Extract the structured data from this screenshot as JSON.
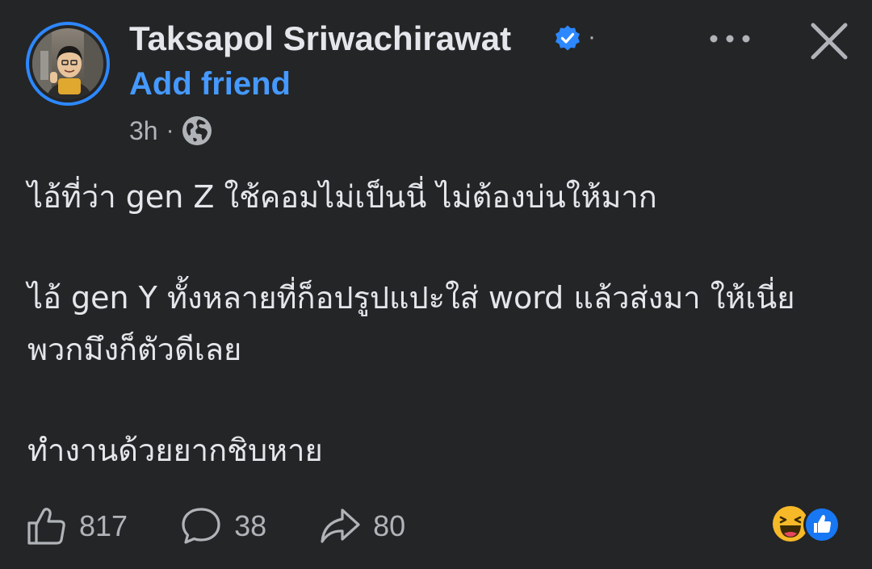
{
  "post": {
    "author": {
      "name": "Taksapol Sriwachirawat",
      "verified": true,
      "add_friend_label": "Add friend"
    },
    "timestamp": "3h",
    "meta_separator": "·",
    "audience_icon": "globe-icon",
    "body": [
      "ไอ้ที่ว่า gen Z ใช้คอมไม่เป็นนี่ ไม่ต้องบ่นให้มาก",
      "ไอ้ gen Y ทั้งหลายที่ก็อปรูปแปะใส่ word แล้วส่งมา ให้เนี่ย พวกมึงก็ตัวดีเลย",
      "ทำงานด้วยยากชิบหาย"
    ],
    "stats": {
      "likes": "817",
      "comments": "38",
      "shares": "80"
    },
    "reaction_icons": [
      "haha-reaction-icon",
      "like-reaction-icon"
    ]
  },
  "colors": {
    "background": "#242526",
    "text_primary": "#e4e6eb",
    "text_secondary": "#b0b3b8",
    "accent_blue": "#4599ff",
    "verified_blue": "#2d88ff",
    "haha_yellow": "#f7b928"
  }
}
